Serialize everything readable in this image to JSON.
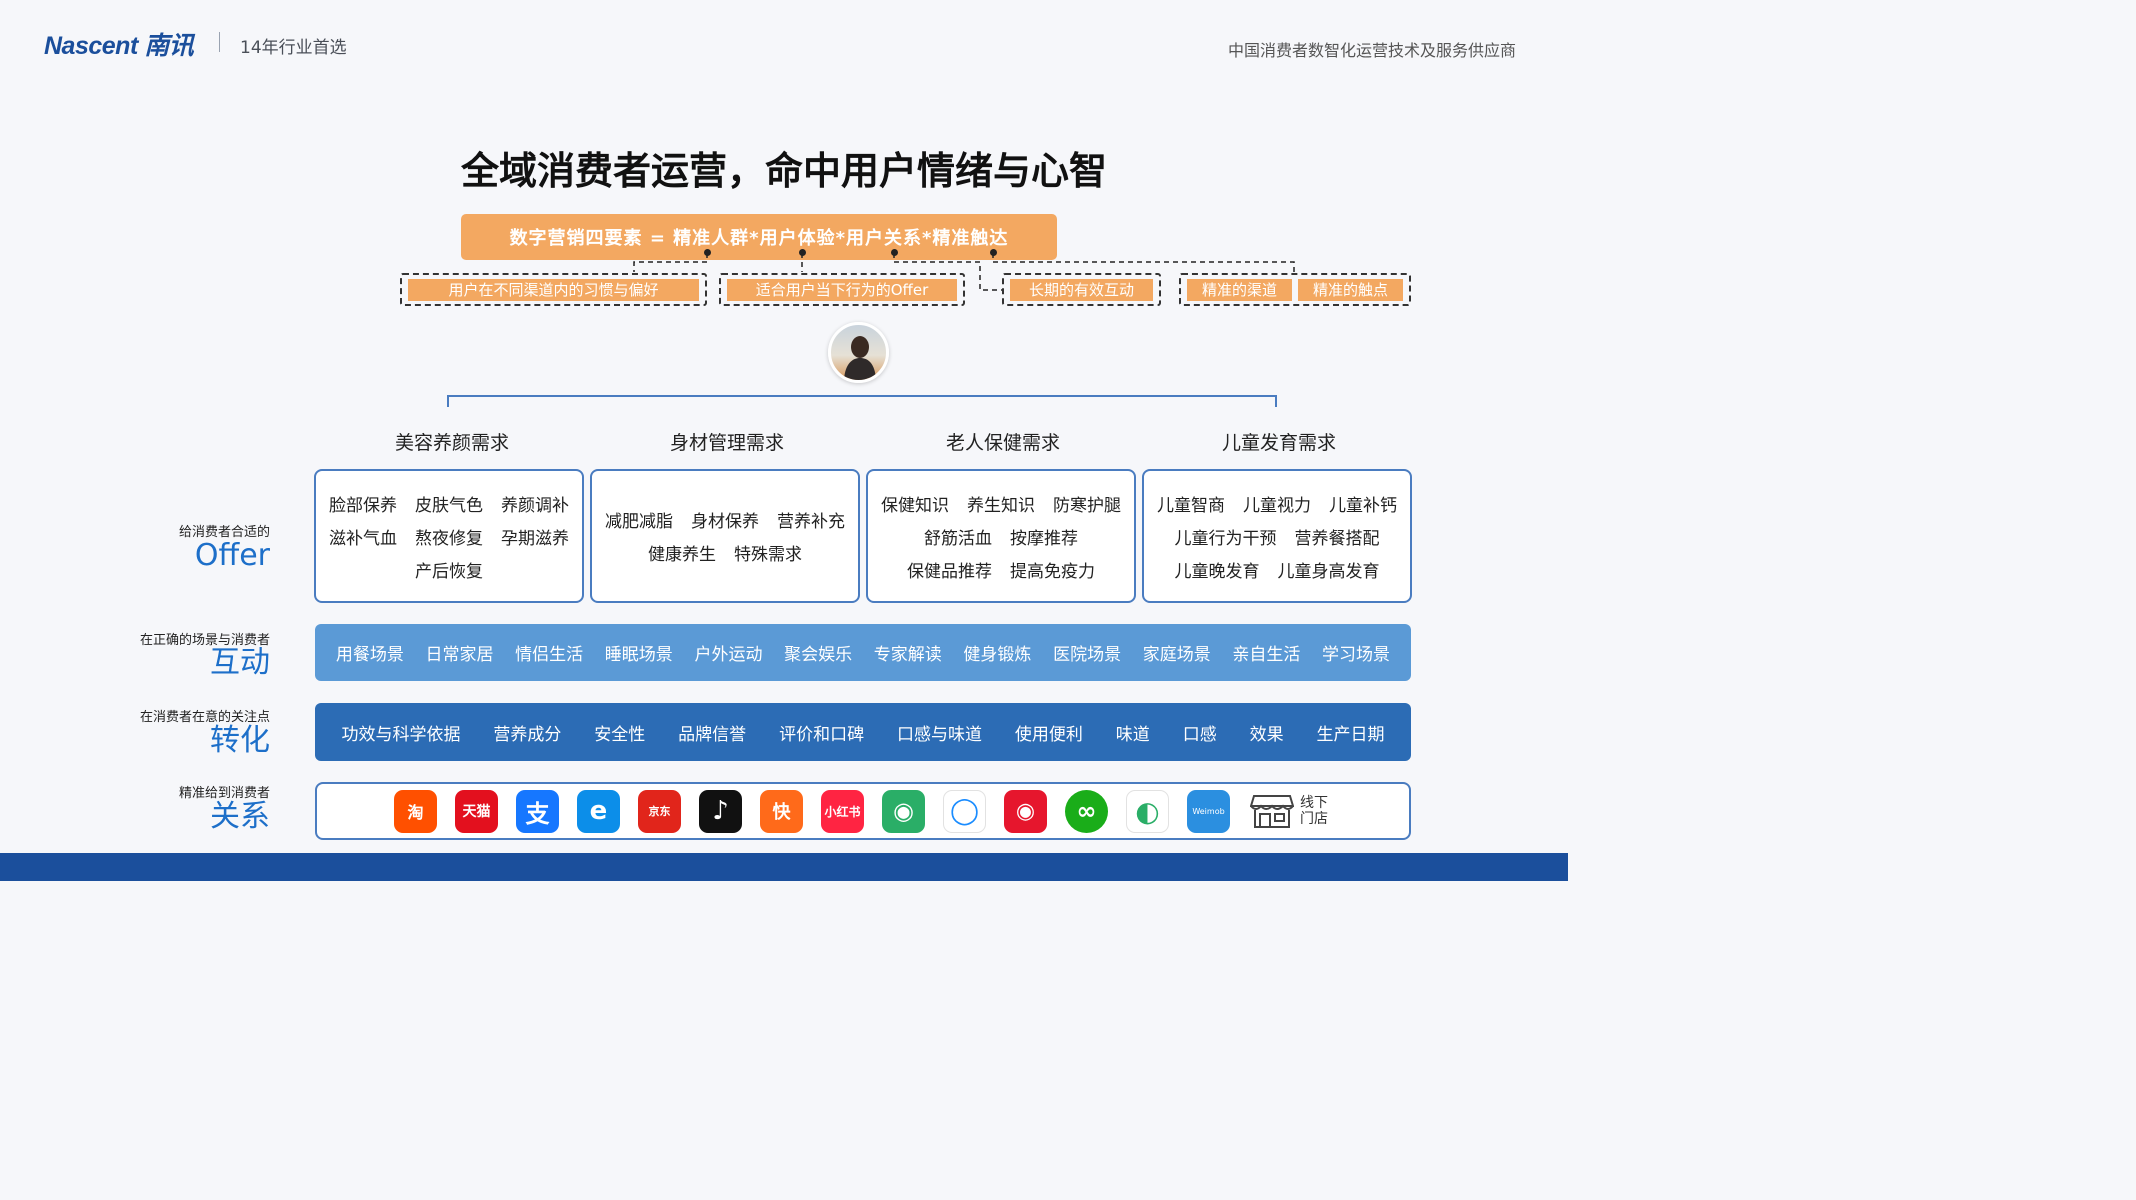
{
  "header": {
    "logo": "Nascent 南讯",
    "tagline": "14年行业首选",
    "slogan": "中国消费者数智化运营技术及服务供应商"
  },
  "title": "全域消费者运营，命中用户情绪与心智",
  "formula": "数字营销四要素 = 精准人群*用户体验*用户关系*精准触达",
  "tags": [
    "用户在不同渠道内的习惯与偏好",
    "适合用户当下行为的Offer",
    "长期的有效互动",
    "精准的渠道",
    "精准的触点"
  ],
  "categories": [
    {
      "title": "美容养颜需求",
      "rows": [
        [
          "脸部保养",
          "皮肤气色",
          "养颜调补"
        ],
        [
          "滋补气血",
          "熬夜修复",
          "孕期滋养"
        ],
        [
          "产后恢复"
        ]
      ]
    },
    {
      "title": "身材管理需求",
      "rows": [
        [
          "减肥减脂",
          "身材保养",
          "营养补充"
        ],
        [
          "健康养生",
          "特殊需求"
        ]
      ]
    },
    {
      "title": "老人保健需求",
      "rows": [
        [
          "保健知识",
          "养生知识",
          "防寒护腿"
        ],
        [
          "舒筋活血",
          "按摩推荐"
        ],
        [
          "保健品推荐",
          "提高免疫力"
        ]
      ]
    },
    {
      "title": "儿童发育需求",
      "rows": [
        [
          "儿童智商",
          "儿童视力",
          "儿童补钙"
        ],
        [
          "儿童行为干预",
          "营养餐搭配"
        ],
        [
          "儿童晚发育",
          "儿童身高发育"
        ]
      ]
    }
  ],
  "sides": {
    "offer": {
      "sub": "给消费者合适的",
      "big": "Offer"
    },
    "interact": {
      "sub": "在正确的场景与消费者",
      "big": "互动"
    },
    "convert": {
      "sub": "在消费者在意的关注点",
      "big": "转化"
    },
    "relation": {
      "sub": "精准给到消费者",
      "big": "关系"
    }
  },
  "scenes": [
    "用餐场景",
    "日常家居",
    "情侣生活",
    "睡眠场景",
    "户外运动",
    "聚会娱乐",
    "专家解读",
    "健身锻炼",
    "医院场景",
    "家庭场景",
    "亲自生活",
    "学习场景"
  ],
  "focus": [
    "功效与科学依据",
    "营养成分",
    "安全性",
    "品牌信誉",
    "评价和口碑",
    "口感与味道",
    "使用便利",
    "味道",
    "口感",
    "效果",
    "生产日期"
  ],
  "channels": [
    {
      "icon": "taobao-icon",
      "glyph": "淘",
      "color": "#ff5000"
    },
    {
      "icon": "tmall-icon",
      "glyph": "天猫",
      "color": "#e3101e"
    },
    {
      "icon": "alipay-icon",
      "glyph": "支",
      "color": "#1677ff"
    },
    {
      "icon": "eleme-icon",
      "glyph": "e",
      "color": "#0c8ee9"
    },
    {
      "icon": "jd-icon",
      "glyph": "京东",
      "color": "#e1251b"
    },
    {
      "icon": "douyin-icon",
      "glyph": "♪",
      "color": "#111111"
    },
    {
      "icon": "kuaishou-icon",
      "glyph": "快",
      "color": "#ff6a1a"
    },
    {
      "icon": "xiaohongshu-icon",
      "glyph": "小红书",
      "color": "#ff2442"
    },
    {
      "icon": "wechat-icon",
      "glyph": "◉",
      "color": "#2aae67"
    },
    {
      "icon": "qq-icon",
      "glyph": "◯",
      "color": "#ffffff"
    },
    {
      "icon": "weibo-icon",
      "glyph": "◉",
      "color": "#e6162d"
    },
    {
      "icon": "mini-program-icon",
      "glyph": "∞",
      "color": "#1aad19"
    },
    {
      "icon": "wecom-icon",
      "glyph": "◐",
      "color": "#ffffff"
    },
    {
      "icon": "weimob-icon",
      "glyph": "Weimob",
      "color": "#2b8fe0"
    }
  ],
  "store": {
    "icon": "store-icon",
    "label": "线下门店"
  }
}
